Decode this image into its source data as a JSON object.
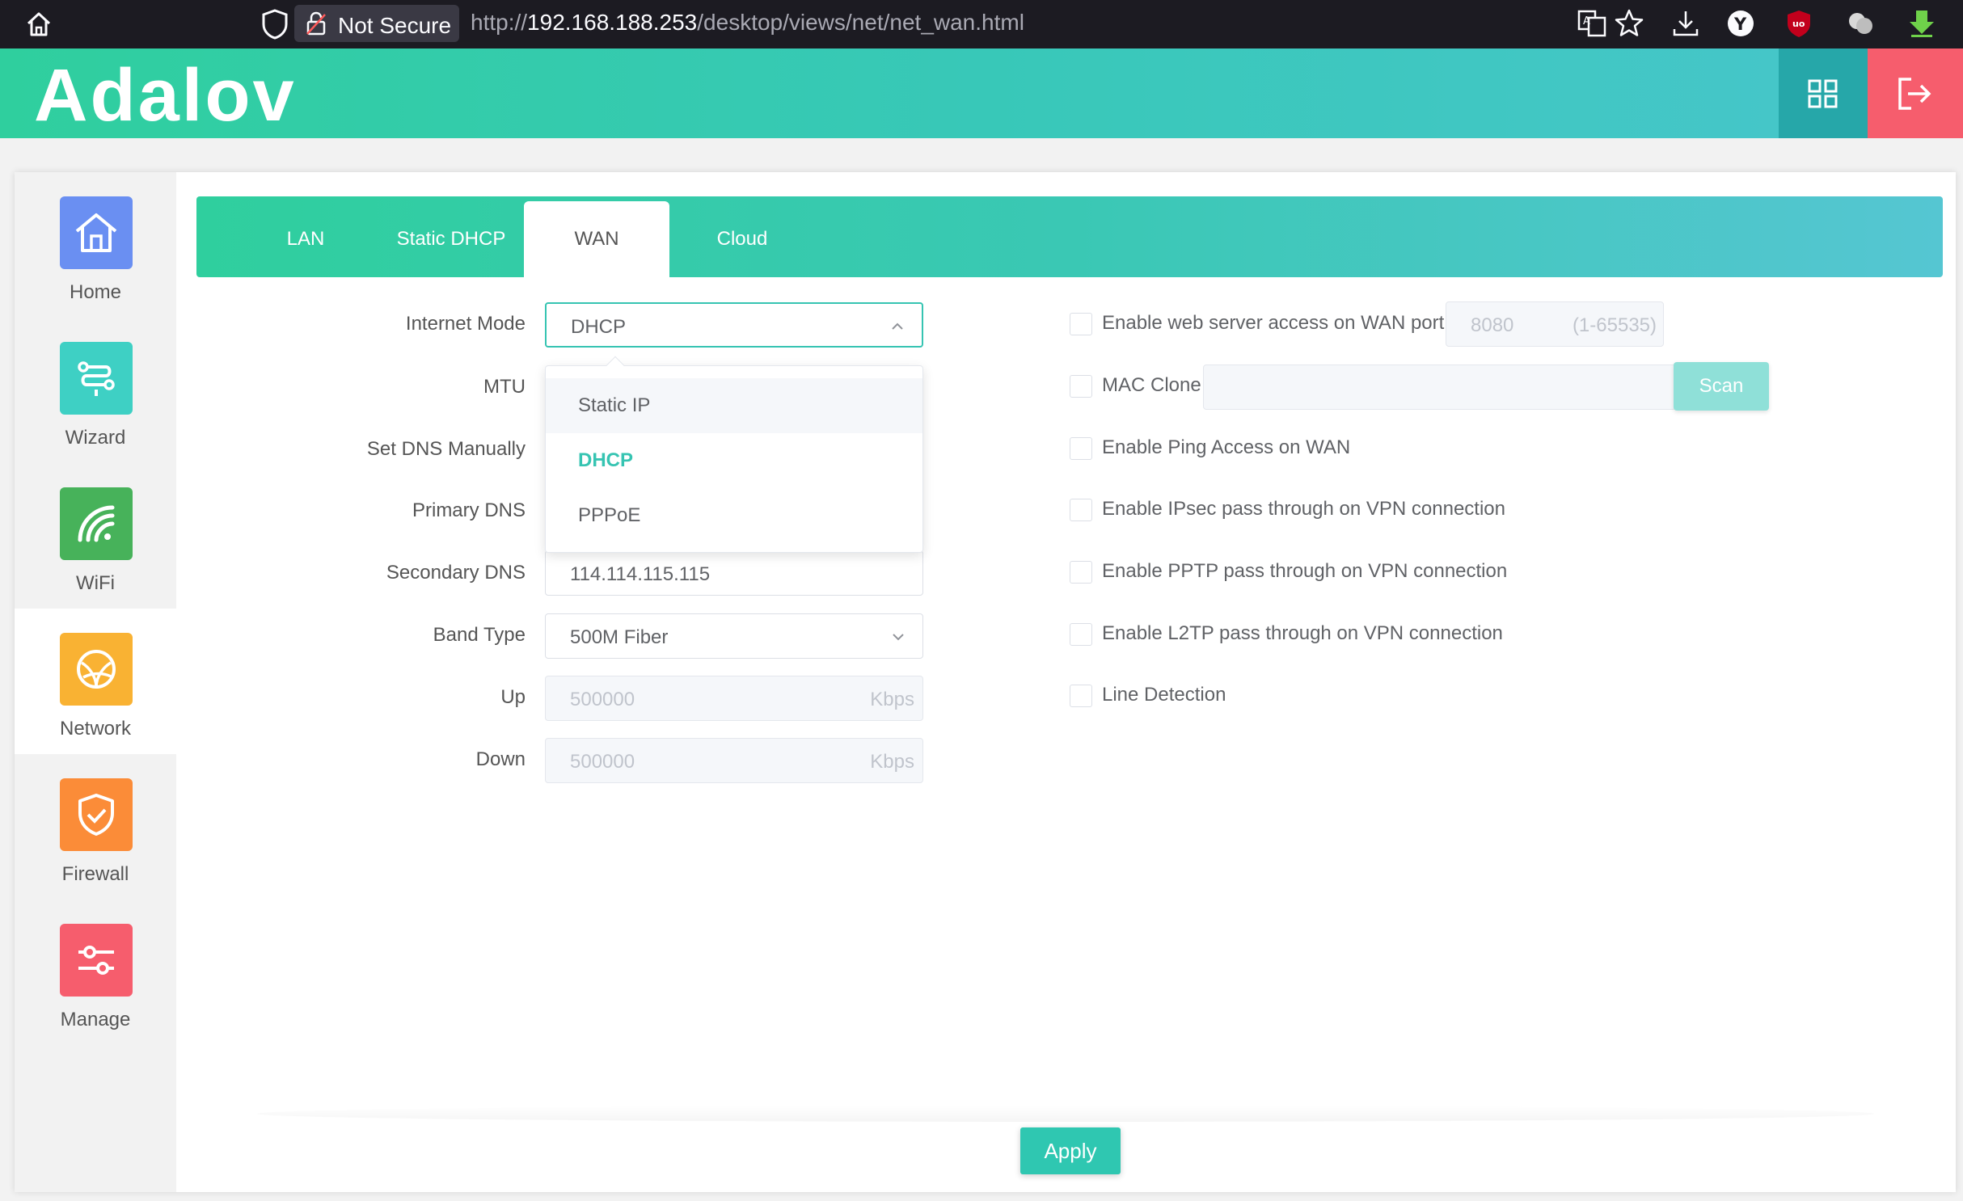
{
  "browser": {
    "security_label": "Not Secure",
    "url_scheme": "http://",
    "url_host": "192.168.188.253",
    "url_path": "/desktop/views/net/net_wan.html",
    "toolbar_icons": [
      "translate-icon",
      "bookmark-star-icon",
      "download-icon",
      "yandex-icon",
      "ublock-icon",
      "extension-icon",
      "download-arrow-icon"
    ]
  },
  "header": {
    "logo_text": "Adalov"
  },
  "sidebar": {
    "items": [
      {
        "label": "Home",
        "icon": "home-icon",
        "color": "#6a8ff2"
      },
      {
        "label": "Wizard",
        "icon": "wizard-icon",
        "color": "#3ed0c4"
      },
      {
        "label": "WiFi",
        "icon": "wifi-icon",
        "color": "#47b25a"
      },
      {
        "label": "Network",
        "icon": "network-icon",
        "color": "#f9b233"
      },
      {
        "label": "Firewall",
        "icon": "firewall-icon",
        "color": "#fb8c38"
      },
      {
        "label": "Manage",
        "icon": "manage-icon",
        "color": "#f65d6d"
      }
    ],
    "active": "Network"
  },
  "tabs": {
    "items": [
      "LAN",
      "Static DHCP",
      "WAN",
      "Cloud"
    ],
    "active": "WAN"
  },
  "form": {
    "internet_mode": {
      "label": "Internet Mode",
      "value": "DHCP"
    },
    "mtu": {
      "label": "MTU"
    },
    "set_dns": {
      "label": "Set DNS Manually"
    },
    "primary_dns": {
      "label": "Primary DNS"
    },
    "secondary_dns": {
      "label": "Secondary DNS",
      "value": "114.114.115.115"
    },
    "band_type": {
      "label": "Band Type",
      "value": "500M Fiber"
    },
    "up": {
      "label": "Up",
      "placeholder": "500000",
      "unit": "Kbps"
    },
    "down": {
      "label": "Down",
      "placeholder": "500000",
      "unit": "Kbps"
    }
  },
  "dropdown": {
    "options": [
      "Static IP",
      "DHCP",
      "PPPoE"
    ],
    "selected": "DHCP",
    "hovered": "Static IP"
  },
  "options": {
    "web_access": {
      "label": "Enable web server access on WAN port",
      "port": "8080",
      "range": "(1-65535)",
      "checked": false
    },
    "mac_clone": {
      "label": "MAC Clone",
      "scan_label": "Scan",
      "checked": false
    },
    "ping": {
      "label": "Enable Ping Access on WAN",
      "checked": false
    },
    "ipsec": {
      "label": "Enable IPsec pass through on VPN connection",
      "checked": false
    },
    "pptp": {
      "label": "Enable PPTP pass through on VPN connection",
      "checked": false
    },
    "l2tp": {
      "label": "Enable L2TP pass through on VPN connection",
      "checked": false
    },
    "line_detection": {
      "label": "Line Detection",
      "checked": false
    }
  },
  "footer": {
    "apply_label": "Apply"
  }
}
